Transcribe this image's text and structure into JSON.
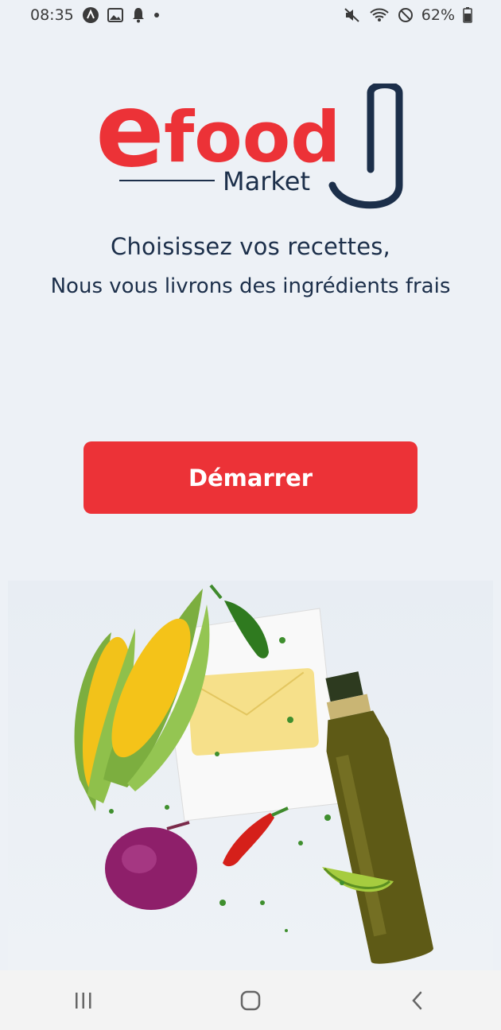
{
  "status_bar": {
    "time": "08:35",
    "battery": "62%",
    "left_icons": [
      "app-icon",
      "gallery-icon",
      "bell-icon",
      "dot-icon"
    ],
    "right_icons": [
      "mute-icon",
      "wifi-icon",
      "dnd-icon",
      "battery-icon"
    ]
  },
  "brand": {
    "name_e": "e",
    "name_food": "food",
    "subtitle": "Market",
    "colors": {
      "red": "#ec3237",
      "navy": "#1c2f4a"
    }
  },
  "tagline": {
    "line1": "Choisissez vos recettes,",
    "line2": "Nous vous livrons des ingrédients frais"
  },
  "start_button": {
    "label": "Démarrer"
  },
  "hero": {
    "items": [
      "corn",
      "jalapeno",
      "butter",
      "olive-oil-bottle",
      "red-chili",
      "red-onion",
      "lime",
      "parsley"
    ]
  },
  "nav_bar": {
    "buttons": [
      "recent-apps",
      "home",
      "back"
    ]
  }
}
